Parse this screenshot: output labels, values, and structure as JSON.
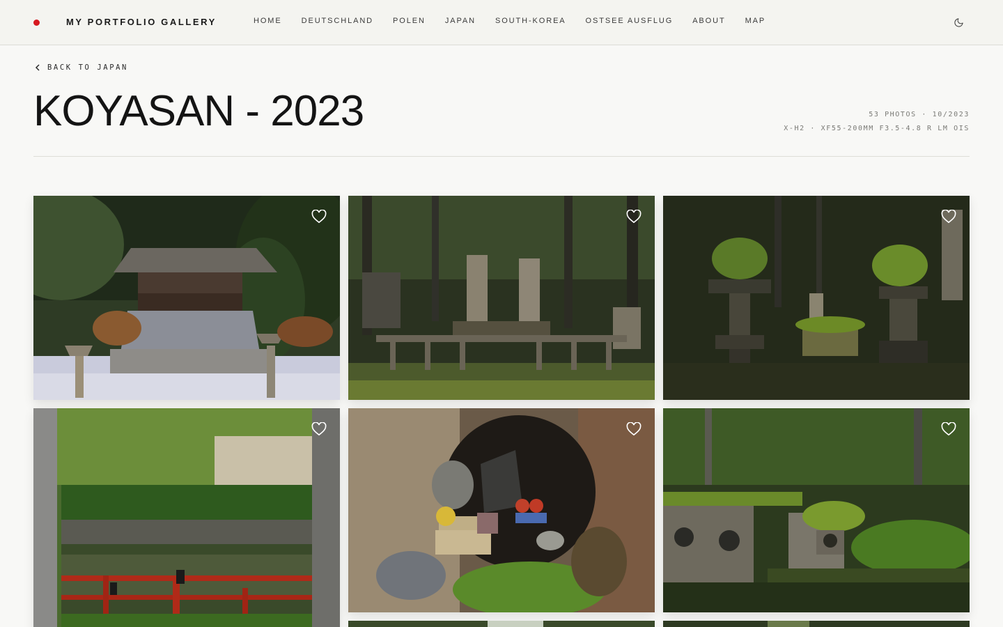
{
  "header": {
    "brand": "MY PORTFOLIO GALLERY",
    "nav": [
      {
        "label": "HOME"
      },
      {
        "label": "DEUTSCHLAND"
      },
      {
        "label": "POLEN"
      },
      {
        "label": "JAPAN"
      },
      {
        "label": "SOUTH-KOREA"
      },
      {
        "label": "OSTSEE AUSFLUG"
      },
      {
        "label": "ABOUT"
      },
      {
        "label": "MAP"
      }
    ],
    "theme_icon": "moon-icon",
    "accent": "#d71920"
  },
  "page": {
    "back_label": "BACK TO JAPAN",
    "title": "KOYASAN - 2023",
    "meta_line1": "53 PHOTOS · 10/2023",
    "meta_line2": "X-H2 · XF55-200MM F3.5-4.8 R LM OIS"
  },
  "gallery": {
    "favorite_icon": "heart-icon",
    "photos": [
      {
        "subject": "temple-hall"
      },
      {
        "subject": "cemetery-stones"
      },
      {
        "subject": "moss-lanterns"
      },
      {
        "subject": "red-bridge-pond"
      },
      {
        "subject": "tree-hollow-shrine"
      },
      {
        "subject": "mossy-graves"
      },
      {
        "subject": "forest"
      },
      {
        "subject": "forest"
      }
    ]
  }
}
